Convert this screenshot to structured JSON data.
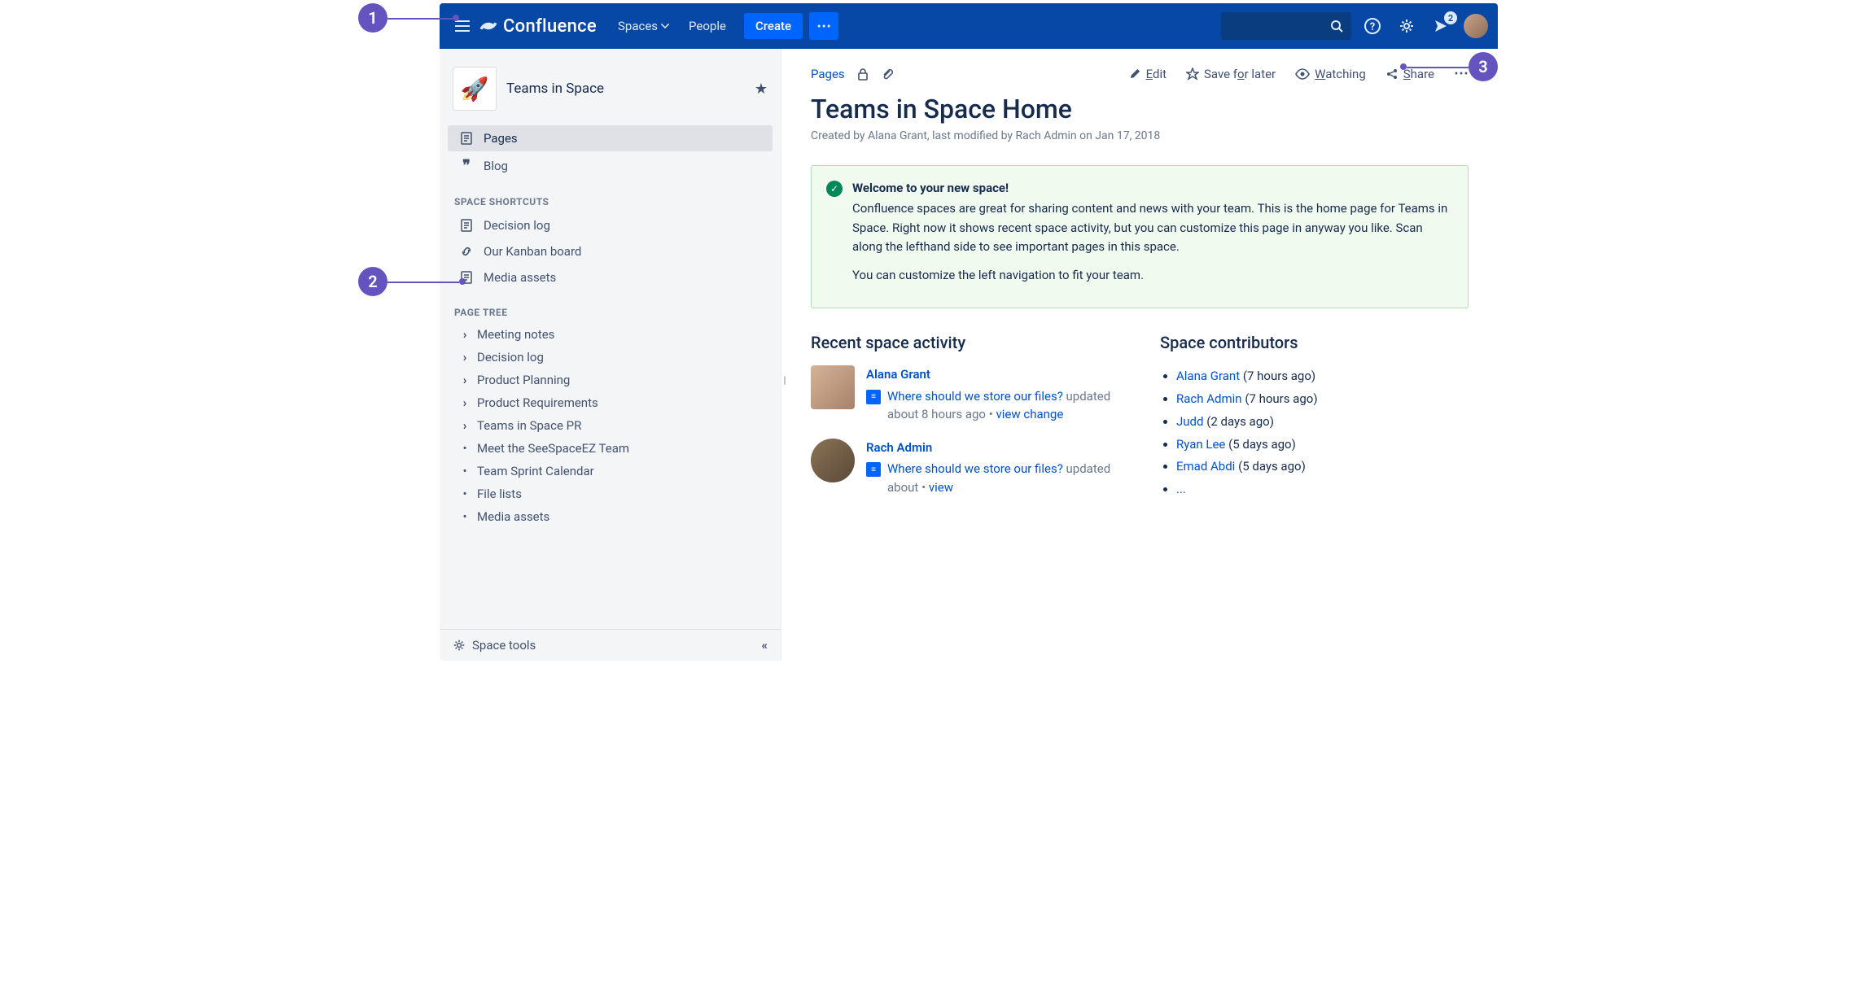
{
  "callouts": {
    "c1": "1",
    "c2": "2",
    "c3": "3"
  },
  "header": {
    "brand": "Confluence",
    "spaces": "Spaces",
    "people": "People",
    "create": "Create",
    "notification_count": "2"
  },
  "sidebar": {
    "space_name": "Teams in Space",
    "nav": {
      "pages": "Pages",
      "blog": "Blog"
    },
    "shortcuts_heading": "SPACE SHORTCUTS",
    "shortcuts": [
      {
        "label": "Decision log",
        "icon": "page"
      },
      {
        "label": "Our Kanban board",
        "icon": "link"
      },
      {
        "label": "Media assets",
        "icon": "page"
      }
    ],
    "tree_heading": "PAGE TREE",
    "tree": [
      {
        "label": "Meeting notes",
        "expandable": true
      },
      {
        "label": "Decision log",
        "expandable": true
      },
      {
        "label": "Product Planning",
        "expandable": true
      },
      {
        "label": "Product Requirements",
        "expandable": true
      },
      {
        "label": "Teams in Space PR",
        "expandable": true
      },
      {
        "label": "Meet the SeeSpaceEZ Team",
        "expandable": false
      },
      {
        "label": "Team Sprint Calendar",
        "expandable": false
      },
      {
        "label": "File lists",
        "expandable": false
      },
      {
        "label": "Media assets",
        "expandable": false
      }
    ],
    "footer": {
      "tools": "Space tools",
      "collapse": "«"
    }
  },
  "toolbar": {
    "pages": "Pages",
    "edit_pre": "E",
    "edit_u": "dit",
    "save_pre": "Save f",
    "save_u": "o",
    "save_post": "r later",
    "watch_u": "W",
    "watch_post": "atching",
    "share_u": "S",
    "share_post": "hare"
  },
  "page": {
    "title": "Teams in Space Home",
    "byline": "Created by Alana Grant, last modified by Rach Admin on Jan 17, 2018"
  },
  "info": {
    "heading": "Welcome to your new space!",
    "para1": "Confluence spaces are great for sharing content and news with your team. This is the home page for Teams in Space. Right now it shows recent space activity, but you can customize this page in anyway you like. Scan along the lefthand side to see important pages in this space.",
    "para2": "You can customize the left navigation to fit your team."
  },
  "activity_heading": "Recent space activity",
  "activity": [
    {
      "user": "Alana Grant",
      "link": "Where should we store our files?",
      "meta": "updated about 8 hours ago",
      "change": "view change"
    },
    {
      "user": "Rach Admin",
      "link": "Where should we store our files?",
      "meta": "updated about",
      "change": "view"
    }
  ],
  "contributors_heading": "Space contributors",
  "contributors": [
    {
      "name": "Alana Grant",
      "ago": "(7 hours ago)"
    },
    {
      "name": "Rach Admin",
      "ago": "(7 hours ago)"
    },
    {
      "name": "Judd",
      "ago": "(2 days ago)"
    },
    {
      "name": "Ryan Lee",
      "ago": "(5 days ago)"
    },
    {
      "name": "Emad Abdi",
      "ago": "(5 days ago)"
    }
  ],
  "contributors_more": "..."
}
